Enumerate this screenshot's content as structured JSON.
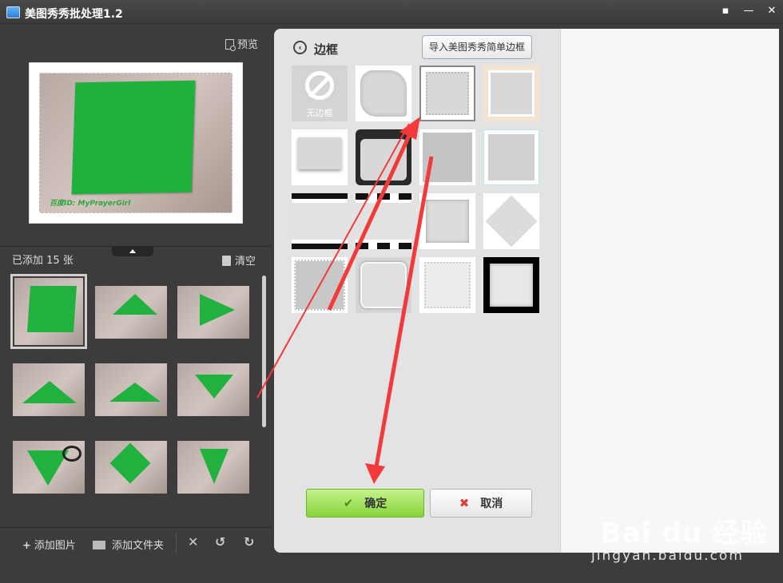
{
  "window": {
    "title": "美图秀秀批处理1.2"
  },
  "left_panel": {
    "preview_label": "预览",
    "preview_watermark": "百度ID: MyPrayerGirl",
    "added_count_label": "已添加 15 张",
    "clear_label": "清空",
    "bottom_bar": {
      "add_image_label": "添加图片",
      "add_folder_label": "添加文件夹"
    }
  },
  "frame_panel": {
    "title": "边框",
    "import_button_label": "导入美图秀秀简单边框",
    "none_label": "无边框",
    "ok_label": "确定",
    "cancel_label": "取消"
  },
  "watermark": {
    "brand": "Bai du 经验",
    "url": "jingyan.baidu.com"
  },
  "colors": {
    "accent_green": "#86d43a",
    "arrow_red": "#f23a3a",
    "paper_green": "#20b13e"
  }
}
